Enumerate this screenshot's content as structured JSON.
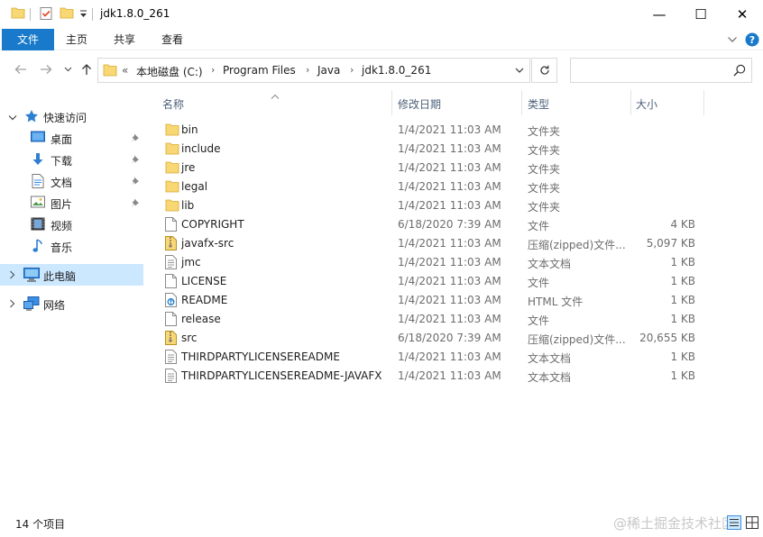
{
  "window": {
    "title": "jdk1.8.0_261",
    "controls": {
      "minimize": "—",
      "maximize": "☐",
      "close": "✕"
    }
  },
  "ribbon": {
    "tabs": [
      {
        "label": "文件",
        "active": true
      },
      {
        "label": "主页",
        "active": false
      },
      {
        "label": "共享",
        "active": false
      },
      {
        "label": "查看",
        "active": false
      }
    ],
    "help_icon": "help-icon"
  },
  "address": {
    "overflow": "«",
    "crumbs": [
      "本地磁盘 (C:)",
      "Program Files",
      "Java",
      "jdk1.8.0_261"
    ],
    "search_placeholder": ""
  },
  "sidebar": {
    "items": [
      {
        "label": "快速访问",
        "icon": "star-icon",
        "pinned": false
      },
      {
        "label": "桌面",
        "icon": "desktop-icon",
        "pinned": true
      },
      {
        "label": "下载",
        "icon": "download-icon",
        "pinned": true
      },
      {
        "label": "文档",
        "icon": "documents-icon",
        "pinned": true
      },
      {
        "label": "图片",
        "icon": "pictures-icon",
        "pinned": true
      },
      {
        "label": "视频",
        "icon": "videos-icon",
        "pinned": false
      },
      {
        "label": "音乐",
        "icon": "music-icon",
        "pinned": false
      },
      {
        "label": "此电脑",
        "icon": "this-pc-icon",
        "pinned": false,
        "selected": true
      },
      {
        "label": "网络",
        "icon": "network-icon",
        "pinned": false
      }
    ]
  },
  "columns": {
    "name": "名称",
    "date": "修改日期",
    "type": "类型",
    "size": "大小"
  },
  "files": [
    {
      "name": "bin",
      "date": "1/4/2021 11:03 AM",
      "type": "文件夹",
      "size": "",
      "icon": "folder"
    },
    {
      "name": "include",
      "date": "1/4/2021 11:03 AM",
      "type": "文件夹",
      "size": "",
      "icon": "folder"
    },
    {
      "name": "jre",
      "date": "1/4/2021 11:03 AM",
      "type": "文件夹",
      "size": "",
      "icon": "folder"
    },
    {
      "name": "legal",
      "date": "1/4/2021 11:03 AM",
      "type": "文件夹",
      "size": "",
      "icon": "folder"
    },
    {
      "name": "lib",
      "date": "1/4/2021 11:03 AM",
      "type": "文件夹",
      "size": "",
      "icon": "folder"
    },
    {
      "name": "COPYRIGHT",
      "date": "6/18/2020 7:39 AM",
      "type": "文件",
      "size": "4 KB",
      "icon": "file"
    },
    {
      "name": "javafx-src",
      "date": "1/4/2021 11:03 AM",
      "type": "压缩(zipped)文件...",
      "size": "5,097 KB",
      "icon": "zip"
    },
    {
      "name": "jmc",
      "date": "1/4/2021 11:03 AM",
      "type": "文本文档",
      "size": "1 KB",
      "icon": "text"
    },
    {
      "name": "LICENSE",
      "date": "1/4/2021 11:03 AM",
      "type": "文件",
      "size": "1 KB",
      "icon": "file"
    },
    {
      "name": "README",
      "date": "1/4/2021 11:03 AM",
      "type": "HTML 文件",
      "size": "1 KB",
      "icon": "html"
    },
    {
      "name": "release",
      "date": "1/4/2021 11:03 AM",
      "type": "文件",
      "size": "1 KB",
      "icon": "file"
    },
    {
      "name": "src",
      "date": "6/18/2020 7:39 AM",
      "type": "压缩(zipped)文件...",
      "size": "20,655 KB",
      "icon": "zip"
    },
    {
      "name": "THIRDPARTYLICENSEREADME",
      "date": "1/4/2021 11:03 AM",
      "type": "文本文档",
      "size": "1 KB",
      "icon": "text"
    },
    {
      "name": "THIRDPARTYLICENSEREADME-JAVAFX",
      "date": "1/4/2021 11:03 AM",
      "type": "文本文档",
      "size": "1 KB",
      "icon": "text"
    }
  ],
  "status": {
    "count": "14 个项目",
    "watermark": "@稀土掘金技术社区"
  },
  "colors": {
    "accent": "#1979ca",
    "selection": "#cce8ff",
    "folder": "#f8d775",
    "header_text": "#4c607a"
  }
}
